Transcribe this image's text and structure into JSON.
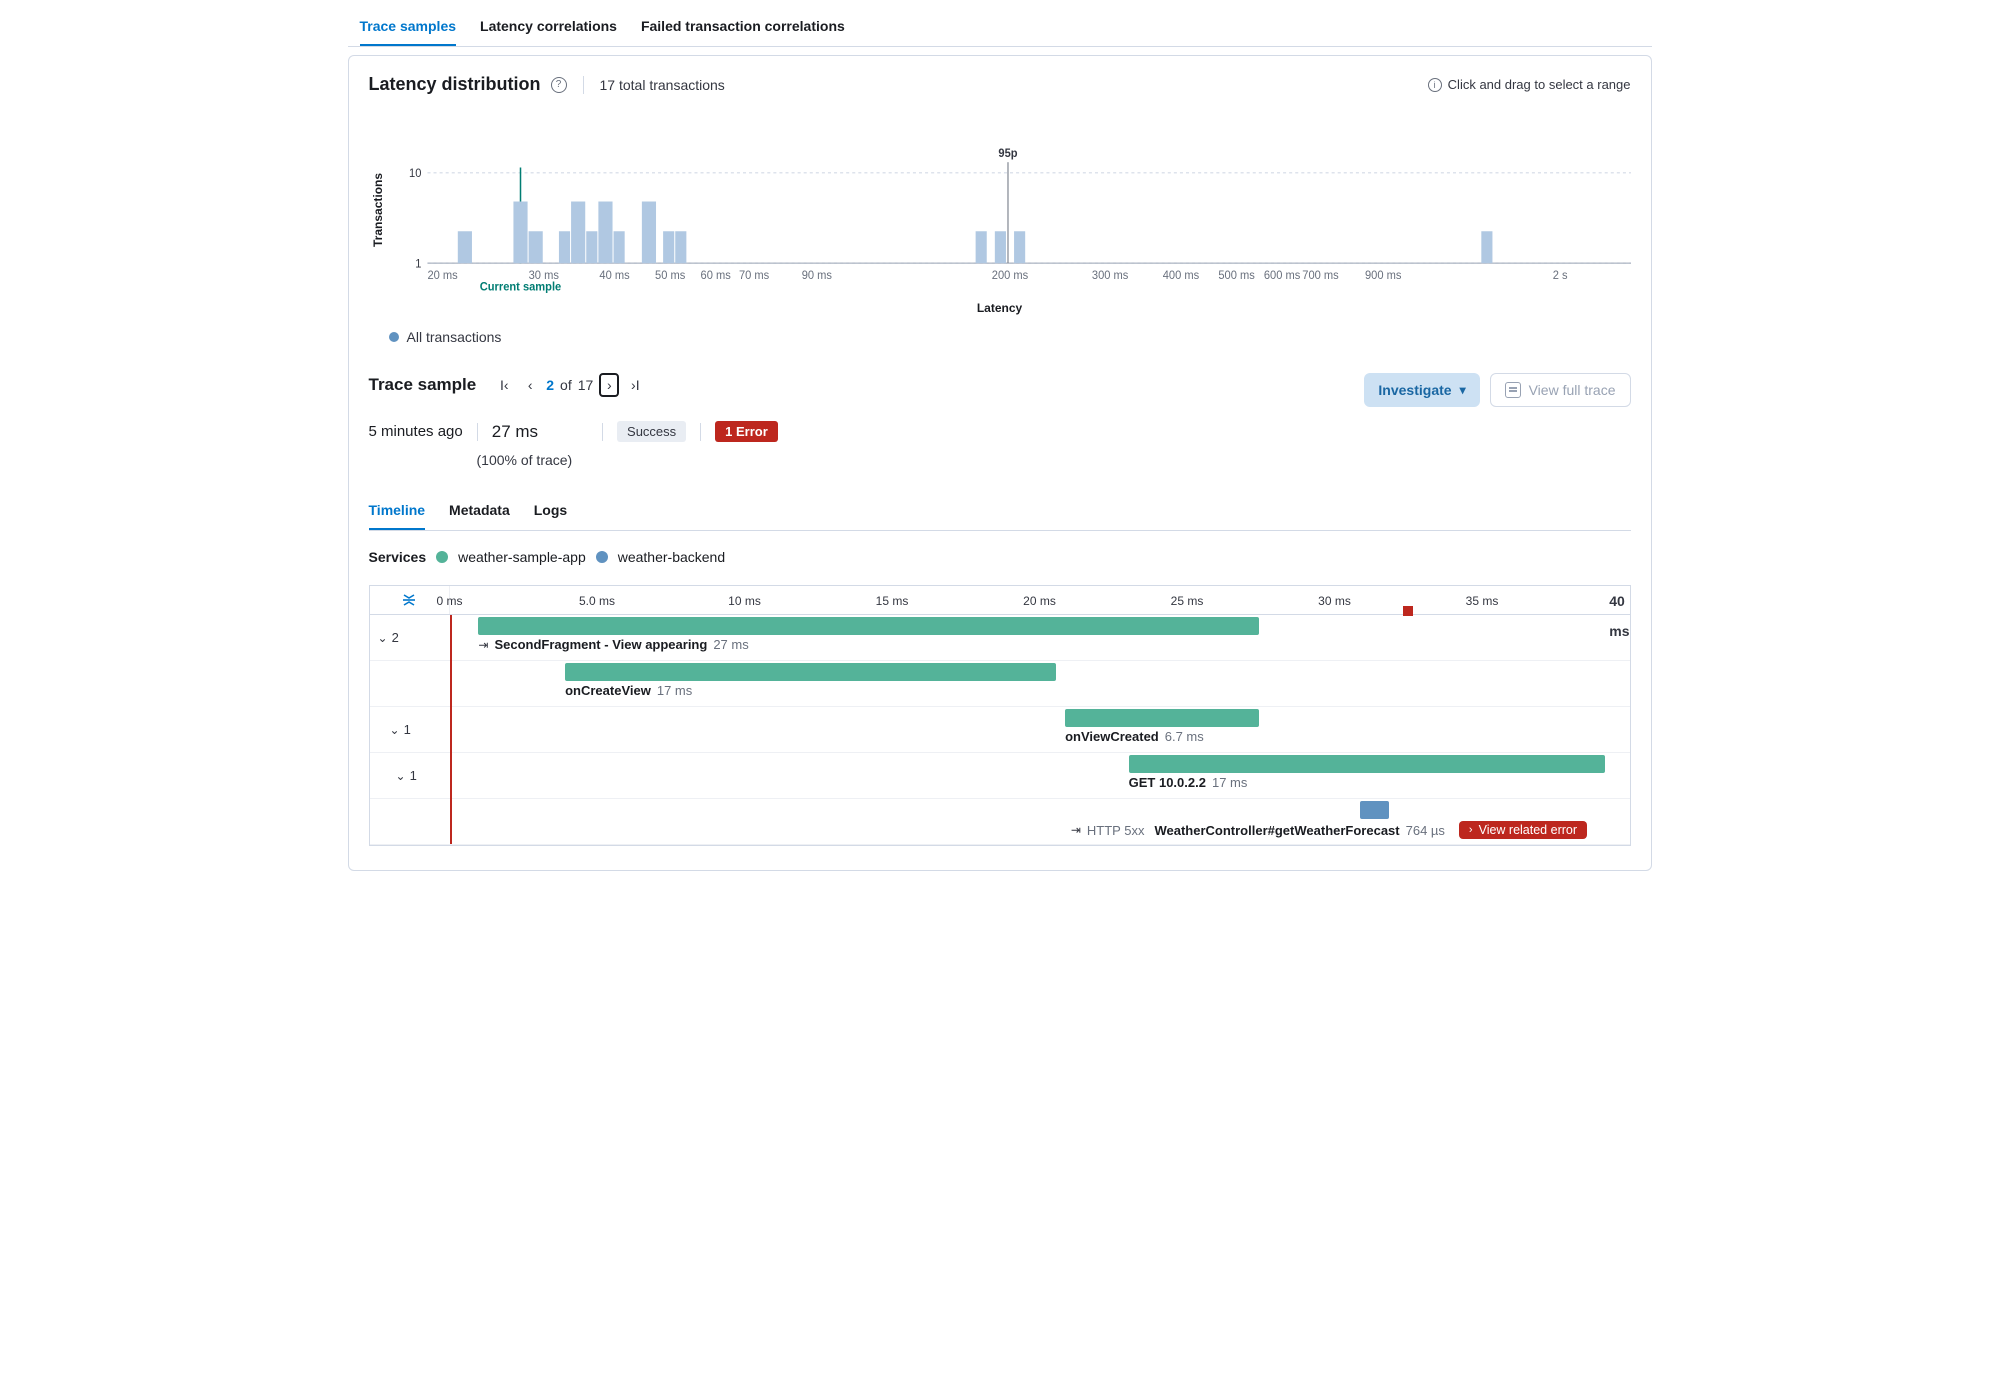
{
  "top_tabs": {
    "trace_samples": "Trace samples",
    "latency_corr": "Latency correlations",
    "failed_corr": "Failed transaction correlations"
  },
  "dist": {
    "title": "Latency distribution",
    "total": "17 total transactions",
    "hint": "Click and drag to select a range",
    "xlabel": "Latency",
    "ylabel": "Transactions",
    "legend": "All transactions",
    "current_sample_label": "Current sample",
    "p95_label": "95p",
    "xticks": [
      "20 ms",
      "30 ms",
      "40 ms",
      "50 ms",
      "60 ms",
      "70 ms",
      "90 ms",
      "200 ms",
      "300 ms",
      "400 ms",
      "500 ms",
      "600 ms",
      "700 ms",
      "900 ms",
      "2 s"
    ],
    "yticks": [
      "1",
      "10"
    ]
  },
  "chart_data": {
    "type": "bar",
    "title": "Latency distribution",
    "xlabel": "Latency",
    "ylabel": "Transactions",
    "x_scale": "log",
    "y_scale": "log",
    "ylim": [
      1,
      10
    ],
    "series": [
      {
        "name": "All transactions",
        "color": "#b0c8e2",
        "x_ms": [
          21,
          27,
          28,
          31,
          35,
          37,
          40,
          41,
          46,
          50,
          51,
          180,
          195,
          210,
          1000
        ],
        "counts": [
          1,
          2,
          1,
          1,
          2,
          1,
          2,
          1,
          2,
          1,
          1,
          1,
          1,
          1,
          1
        ]
      }
    ],
    "annotations": {
      "current_sample_ms": 27,
      "p95_ms": 200
    }
  },
  "trace_sample": {
    "title": "Trace sample",
    "current": "2",
    "of": "of",
    "total": "17",
    "age": "5 minutes ago",
    "duration": "27 ms",
    "status": "Success",
    "error_badge": "1 Error",
    "pct": "(100% of trace)",
    "investigate": "Investigate",
    "view_full": "View full trace"
  },
  "sub_tabs": {
    "timeline": "Timeline",
    "metadata": "Metadata",
    "logs": "Logs"
  },
  "services": {
    "label": "Services",
    "items": [
      {
        "name": "weather-sample-app",
        "color": "#54b399"
      },
      {
        "name": "weather-backend",
        "color": "#6092c0"
      }
    ]
  },
  "waterfall": {
    "ticks": [
      "0 ms",
      "5.0 ms",
      "10 ms",
      "15 ms",
      "20 ms",
      "25 ms",
      "30 ms",
      "35 ms",
      "40 ms"
    ],
    "total_ms": 40,
    "error_marker_ms": 32.5,
    "rows": [
      {
        "child_count": "2",
        "bar": {
          "start_ms": 1,
          "end_ms": 28,
          "color": "green"
        },
        "label_offset_ms": 1,
        "icon": "exit",
        "name": "SecondFragment - View appearing",
        "dur": "27 ms"
      },
      {
        "bar": {
          "start_ms": 4,
          "end_ms": 21,
          "color": "green"
        },
        "label_offset_ms": 4,
        "name": "onCreateView",
        "dur": "17 ms"
      },
      {
        "child_count": "1",
        "bar": {
          "start_ms": 21.3,
          "end_ms": 28,
          "color": "green"
        },
        "label_offset_ms": 21.3,
        "name": "onViewCreated",
        "dur": "6.7 ms"
      },
      {
        "child_count": "1",
        "bar": {
          "start_ms": 23.5,
          "end_ms": 40,
          "color": "green"
        },
        "label_offset_ms": 23.5,
        "name": "GET 10.0.2.2",
        "dur": "17 ms"
      },
      {
        "bar": {
          "start_ms": 31.5,
          "end_ms": 32.5,
          "color": "blue"
        },
        "label_offset_ms": 21.5,
        "icon": "exit",
        "pre_label": "HTTP 5xx",
        "name": "WeatherController#getWeatherForecast",
        "dur": "764 µs",
        "error_button": "View related error",
        "red_vline_ms": 0
      }
    ]
  }
}
